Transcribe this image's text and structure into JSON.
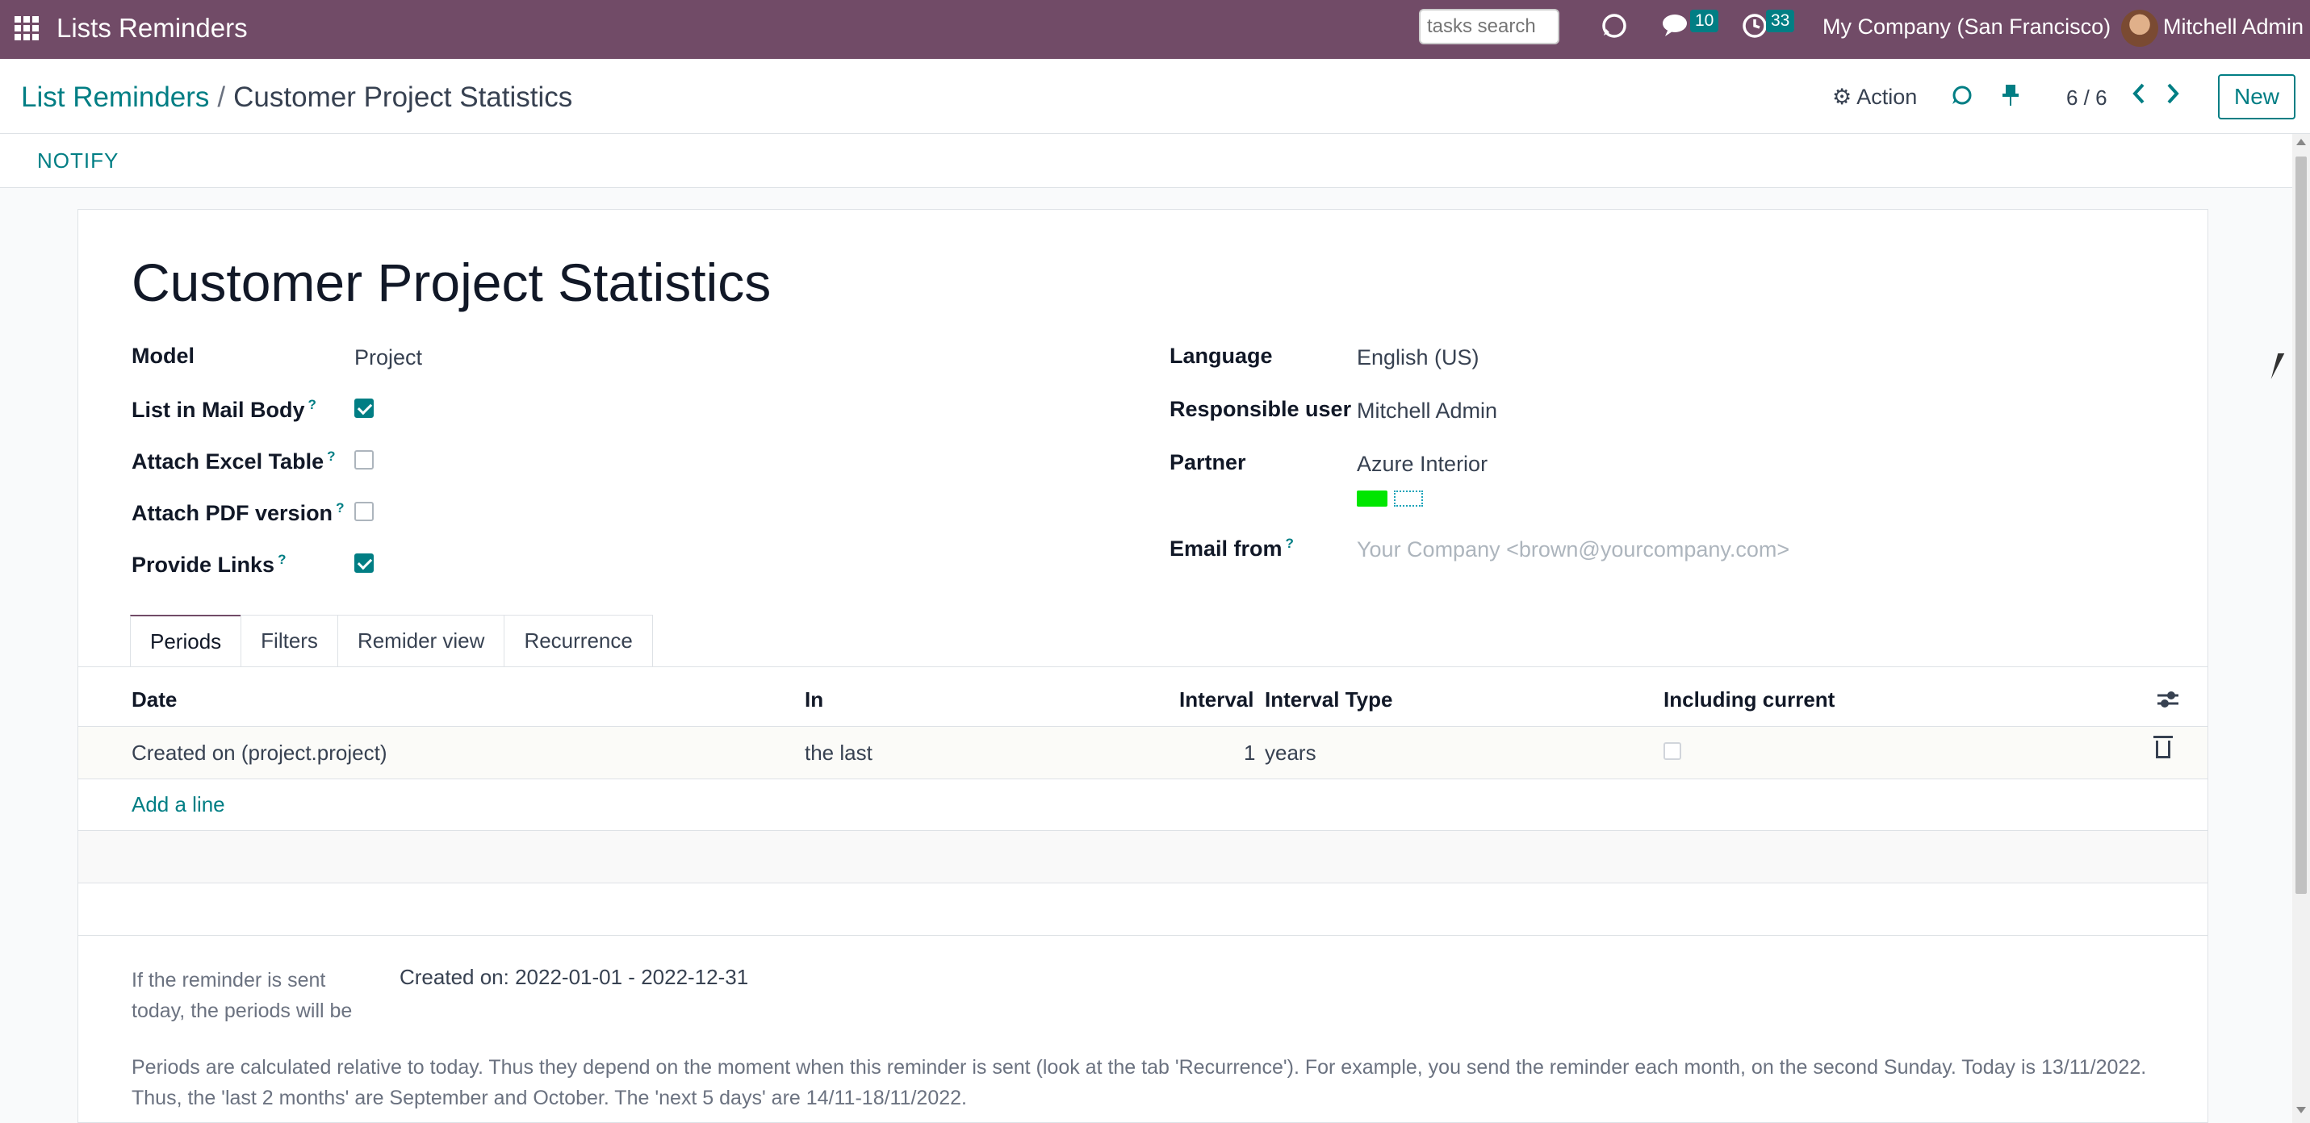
{
  "navbar": {
    "app_title": "Lists Reminders",
    "search_placeholder": "tasks search",
    "messages_count": "10",
    "activities_count": "33",
    "company": "My Company (San Francisco)",
    "user": "Mitchell Admin",
    "brand_color": "#714b67"
  },
  "control": {
    "breadcrumb_parent": "List Reminders",
    "breadcrumb_separator": "/",
    "breadcrumb_current": "Customer Project Statistics",
    "action_label": "Action",
    "pager": "6 / 6",
    "new_label": "New"
  },
  "statusbar": {
    "notify_label": "NOTIFY"
  },
  "record": {
    "title": "Customer Project Statistics",
    "left_fields": {
      "model_label": "Model",
      "model_value": "Project",
      "list_in_mail_body_label": "List in Mail Body",
      "list_in_mail_body": true,
      "attach_excel_label": "Attach Excel Table",
      "attach_excel": false,
      "attach_pdf_label": "Attach PDF version",
      "attach_pdf": false,
      "provide_links_label": "Provide Links",
      "provide_links": true
    },
    "right_fields": {
      "language_label": "Language",
      "language_value": "English (US)",
      "responsible_label": "Responsible user",
      "responsible_value": "Mitchell Admin",
      "partner_label": "Partner",
      "partner_value": "Azure Interior",
      "email_from_label": "Email from",
      "email_from_placeholder": "Your Company <brown@yourcompany.com>"
    },
    "help_mark": "?"
  },
  "tabs": [
    "Periods",
    "Filters",
    "Remider view",
    "Recurrence"
  ],
  "periods_table": {
    "headers": {
      "date": "Date",
      "in": "In",
      "interval": "Interval",
      "interval_type": "Interval Type",
      "including_current": "Including current"
    },
    "rows": [
      {
        "date": "Created on (project.project)",
        "in": "the last",
        "interval": "1",
        "interval_type": "years",
        "including_current": false
      }
    ],
    "add_line_label": "Add a line"
  },
  "info": {
    "label": "If the reminder is sent today, the periods will be",
    "value": "Created on: 2022-01-01 - 2022-12-31",
    "explanation": "Periods are calculated relative to today. Thus they depend on the moment when this reminder is sent (look at the tab 'Recurrence'). For example, you send the reminder each month, on the second Sunday. Today is 13/11/2022. Thus, the 'last 2 months' are September and October. The 'next 5 days' are 14/11-18/11/2022."
  }
}
